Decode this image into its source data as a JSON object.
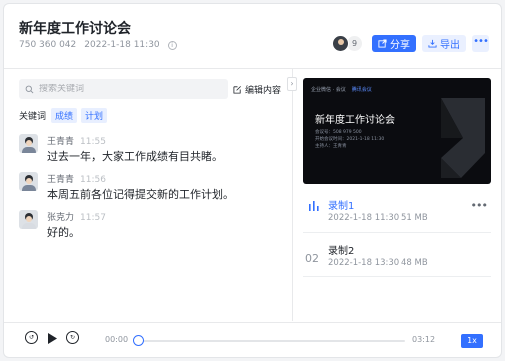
{
  "header": {
    "title": "新年度工作讨论会",
    "meeting_id": "750 360 042",
    "datetime": "2022-1-18 11:30",
    "participant_count": "9",
    "share_label": "分享",
    "export_label": "导出"
  },
  "left": {
    "search_placeholder": "搜索关键词",
    "edit_label": "编辑内容",
    "keywords_label": "关键词",
    "keywords": [
      "成绩",
      "计划"
    ]
  },
  "messages": [
    {
      "name": "王青青",
      "time": "11:55",
      "text": "过去一年，大家工作成绩有目共睹。"
    },
    {
      "name": "王青青",
      "time": "11:56",
      "text": "本周五前各位记得提交新的工作计划。"
    },
    {
      "name": "张克力",
      "time": "11:57",
      "text": "好的。"
    }
  ],
  "video": {
    "logo_left": "企业微信 · 会议",
    "logo_right": "腾讯会议",
    "title": "新年度工作讨论会",
    "lines": [
      "会议号：508 979 500",
      "开始会议时间：2021-1-18 11:30",
      "主持人：王青青"
    ]
  },
  "recordings": [
    {
      "index": "",
      "name": "录制1",
      "date": "2022-1-18 11:30",
      "size": "51 MB",
      "active": true
    },
    {
      "index": "02",
      "name": "录制2",
      "date": "2022-1-18 13:30",
      "size": "48 MB",
      "active": false
    }
  ],
  "player": {
    "current_time": "00:00",
    "total_time": "03:12",
    "progress": 0,
    "speed": "1x"
  },
  "colors": {
    "accent": "#3370ff",
    "text": "#1f2329",
    "muted": "#8f959e"
  }
}
